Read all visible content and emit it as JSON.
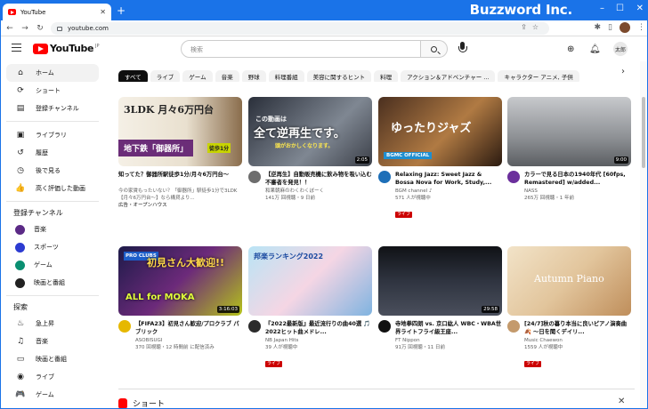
{
  "browser": {
    "tab_title": "YouTube",
    "tab_close": "✕",
    "new_tab": "+",
    "brand": "Buzzword Inc.",
    "url": "youtube.com"
  },
  "header": {
    "logo_text": "YouTube",
    "logo_suffix": "JP",
    "search_placeholder": "検索",
    "avatar_text": "太郎"
  },
  "sidebar": {
    "main": [
      {
        "label": "ホーム",
        "icon": "home-icon",
        "glyph": "⌂"
      },
      {
        "label": "ショート",
        "icon": "shorts-icon",
        "glyph": "⟳"
      },
      {
        "label": "登録チャンネル",
        "icon": "subscriptions-icon",
        "glyph": "▤"
      }
    ],
    "library": [
      {
        "label": "ライブラリ",
        "icon": "library-icon",
        "glyph": "▣"
      },
      {
        "label": "履歴",
        "icon": "history-icon",
        "glyph": "↺"
      },
      {
        "label": "後で見る",
        "icon": "watch-later-icon",
        "glyph": "◷"
      },
      {
        "label": "高く評価した動画",
        "icon": "like-icon",
        "glyph": "👍"
      }
    ],
    "subs_heading": "登録チャンネル",
    "subs": [
      {
        "label": "音楽",
        "color": "#5b2a86"
      },
      {
        "label": "スポーツ",
        "color": "#2c3bd1"
      },
      {
        "label": "ゲーム",
        "color": "#0a8f71"
      },
      {
        "label": "映画と番組",
        "color": "#222222"
      }
    ],
    "explore_heading": "探索",
    "explore": [
      {
        "label": "急上昇",
        "icon": "trending-icon",
        "glyph": "♨"
      },
      {
        "label": "音楽",
        "icon": "music-icon",
        "glyph": "♫"
      },
      {
        "label": "映画と番組",
        "icon": "movies-icon",
        "glyph": "▭"
      },
      {
        "label": "ライブ",
        "icon": "live-icon",
        "glyph": "◉"
      },
      {
        "label": "ゲーム",
        "icon": "gaming-icon",
        "glyph": "🎮"
      }
    ]
  },
  "chips": [
    "すべて",
    "ライブ",
    "ゲーム",
    "音楽",
    "野球",
    "料理番組",
    "美容に関するヒント",
    "料理",
    "アクション＆アドベンチャー ...",
    "キャラクター アニメ, 子供"
  ],
  "videos": [
    {
      "title": "知ってた？御器所駅徒歩1分/月々6万円台～",
      "line2": "今の家賃もったいない？「御器所」駅徒歩1分で3LDK【月々6万円台～】なら構貸より...",
      "channel": "",
      "stats": "",
      "ad": "広告・オープンハウス",
      "duration": "",
      "avatar": "",
      "live": ""
    },
    {
      "title": "【逆再生】自動販売機に飲み物を吸い込む不審者を発見！！",
      "channel": "和果朝麻のわくわくぼーく",
      "stats": "141万 回視聴・9 日前",
      "duration": "2:05",
      "avatar": "#6d6d6d",
      "live": ""
    },
    {
      "title": "Relaxing Jazz: Sweet Jazz & Bossa Nova for Work, Study,...",
      "channel": "BGM channel ♪",
      "stats": "571 人が視聴中",
      "duration": "",
      "avatar": "#1d6fb8",
      "live": "ライブ"
    },
    {
      "title": "カラーで見る日本の1940年代 [60fps, Remastered] w/added...",
      "channel": "NASS",
      "stats": "265万 回視聴・1 年前",
      "duration": "9:00",
      "avatar": "#6b2f9c",
      "live": ""
    },
    {
      "title": "【FIFA23】初見さん歓迎/プロクラブ パブリック",
      "channel": "ASOBISUGI",
      "stats": "370 回視聴・12 時間前 に配信済み",
      "duration": "3:16:03",
      "avatar": "#e6b800",
      "live": ""
    },
    {
      "title": "『2022最新版』最近流行りの曲40選 🎵 2022ヒット曲メドレ...",
      "channel": "NB Japan Hits",
      "stats": "39 人が視聴中",
      "duration": "",
      "avatar": "#2b2b2b",
      "live": "ライブ"
    },
    {
      "title": "寺地拳四朗 vs. 京口紘人 WBC・WBA世界ライトフライ級王座...",
      "channel": "FT Nippon",
      "stats": "91万 回視聴・11 日前",
      "duration": "29:58",
      "avatar": "#111111",
      "live": ""
    },
    {
      "title": "[24/7]秋の暮り本当に良いピアノ演奏曲 🍂 ～日を聞くデイリ...",
      "channel": "Music Chaewon",
      "stats": "1559 人が視聴中",
      "duration": "",
      "avatar": "#c49a6c",
      "live": "ライブ"
    }
  ],
  "thumbs": {
    "v1_main": "3LDK 月々6万円台",
    "v1_sub": "地下鉄「御器所」",
    "v1_walk": "徒歩1分",
    "v2_top": "この動画は",
    "v2_main": "全て逆再生です。",
    "v2_sub": "頭がおかしくなります。",
    "v3_main": "ゆったりジャズ",
    "v3_badge": "BGMC OFFICIAL",
    "v5_main": "初見さん大歓迎!!",
    "v5_sub": "ALL for MOKA",
    "v5_pro": "PRO CLUBS",
    "v6_main": "邦楽ランキング2022",
    "v8_main": "Autumn Piano"
  },
  "shorts_label": "ショート",
  "shorts_close": "✕"
}
